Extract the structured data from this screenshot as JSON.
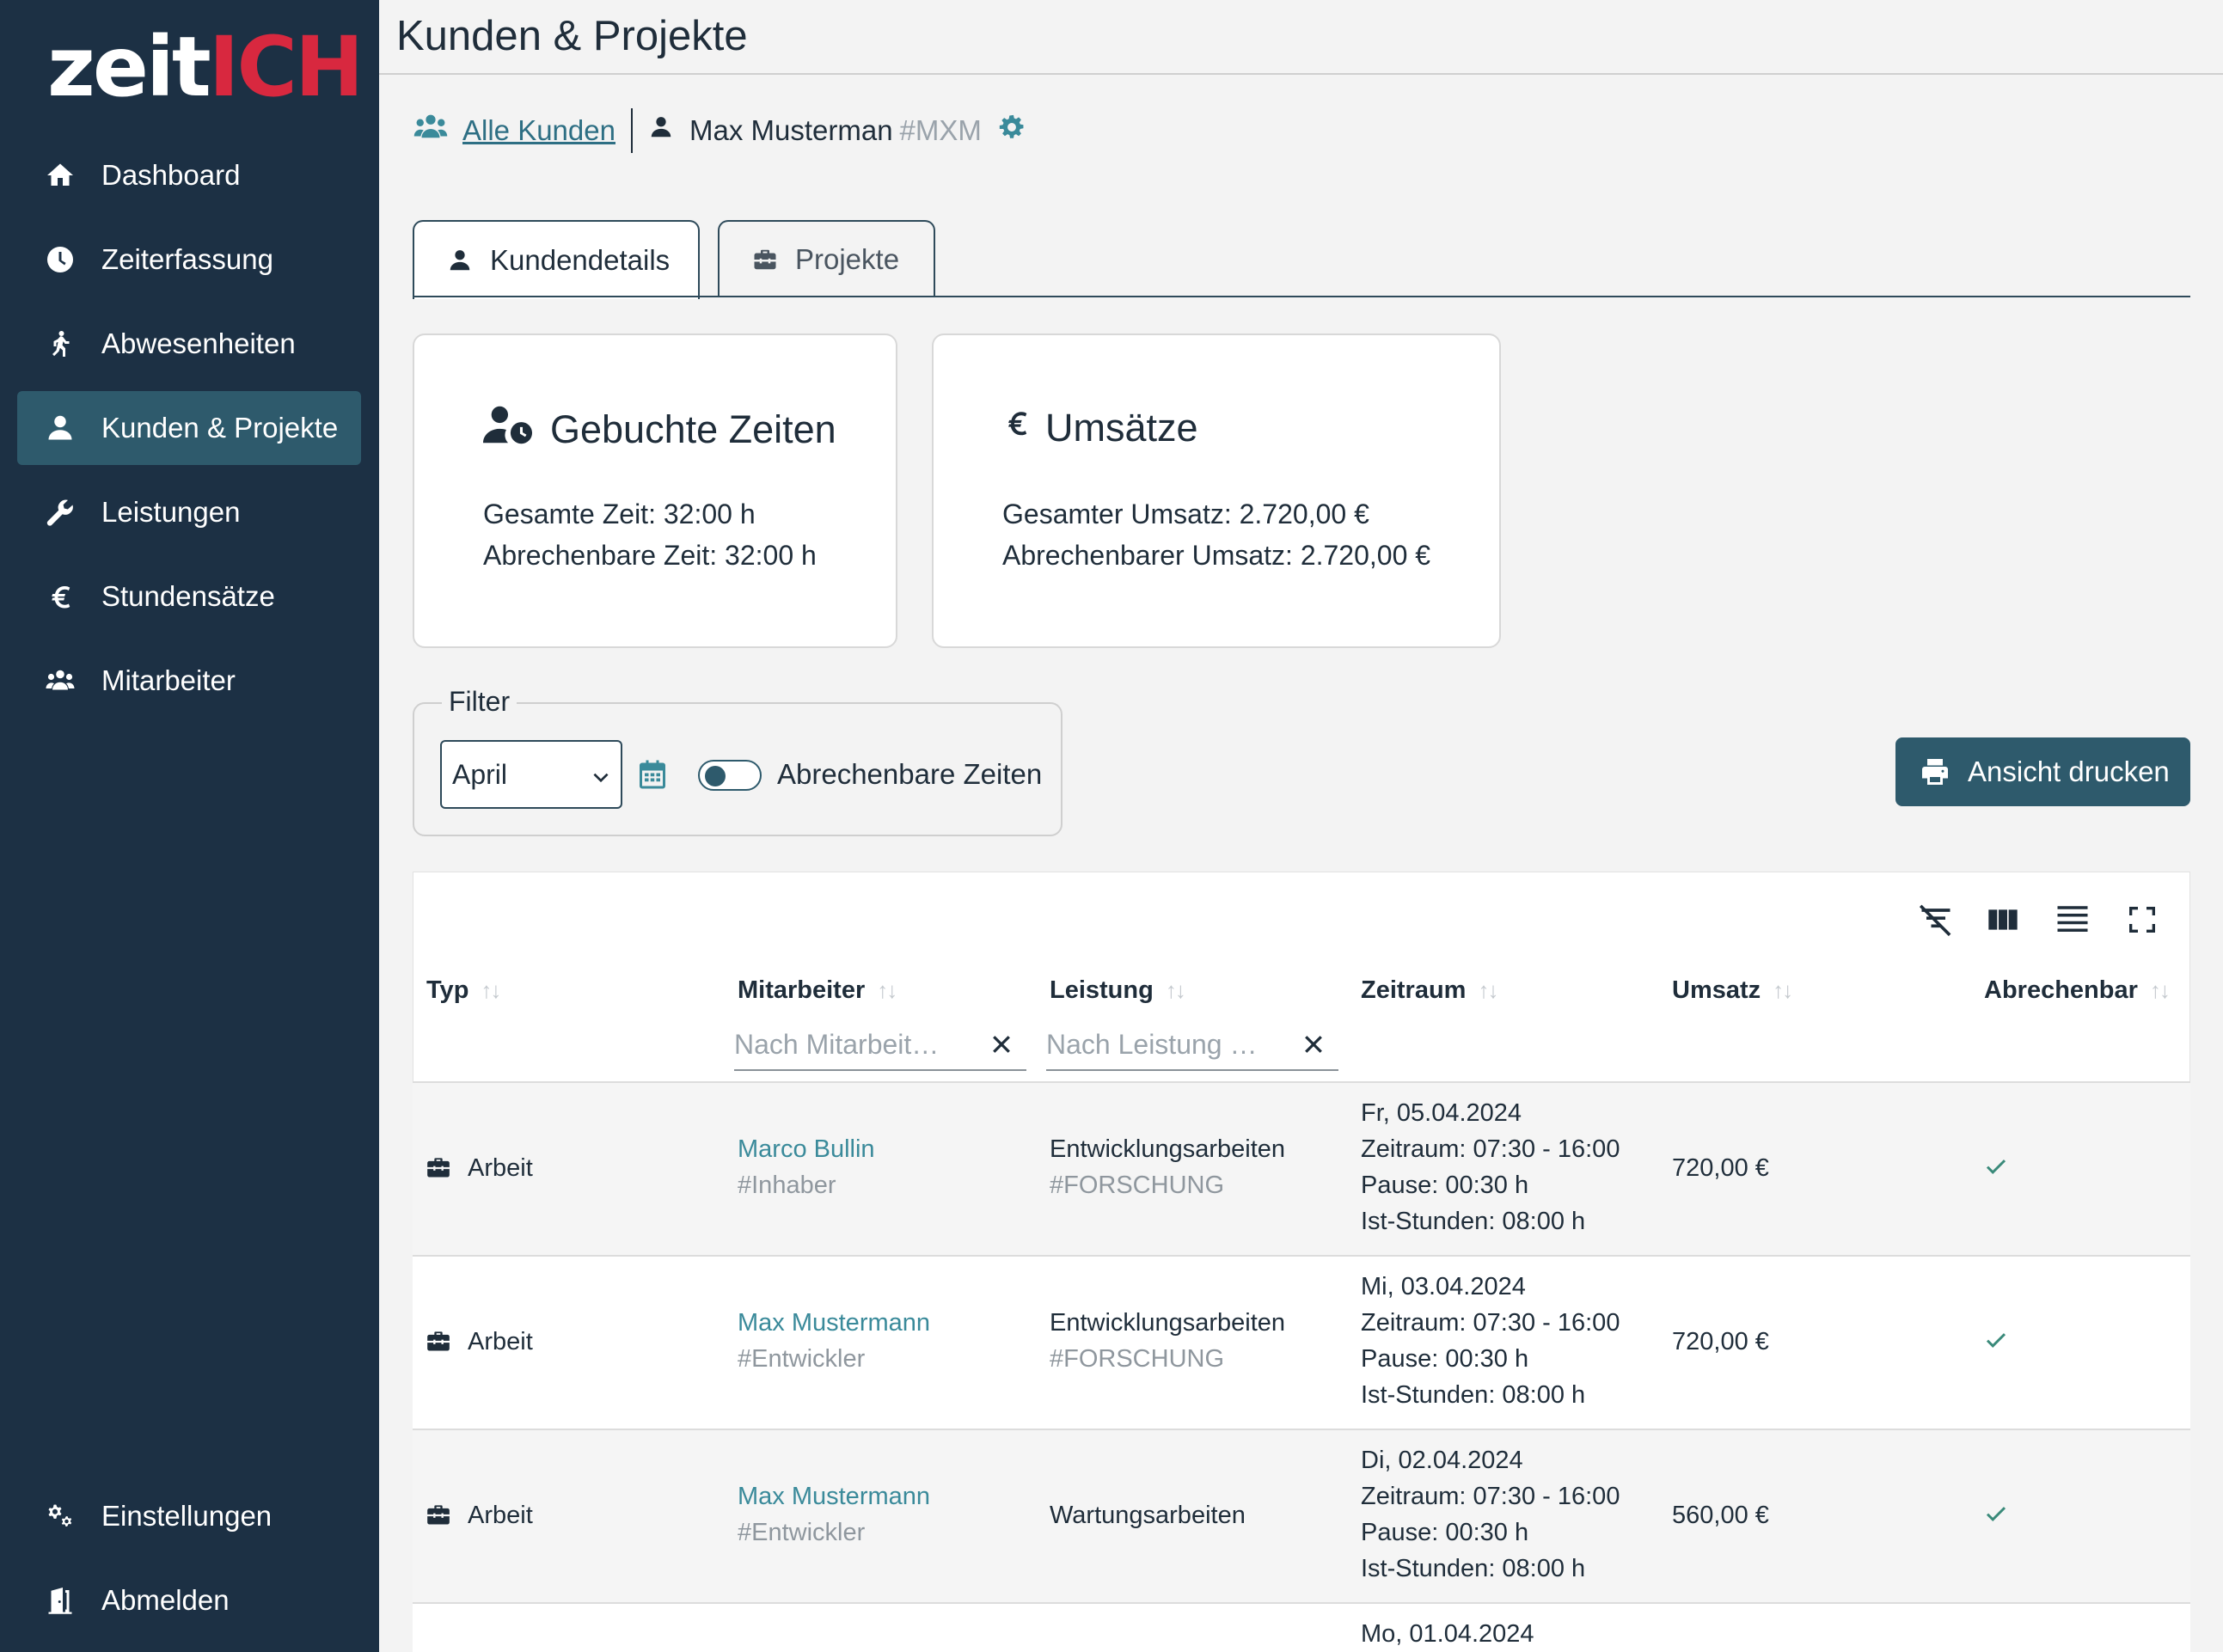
{
  "app": {
    "logo_part1": "zeit",
    "logo_part2": "ICH"
  },
  "sidebar": {
    "items": [
      {
        "label": "Dashboard",
        "icon": "home-icon"
      },
      {
        "label": "Zeiterfassung",
        "icon": "clock-icon"
      },
      {
        "label": "Abwesenheiten",
        "icon": "walking-icon"
      },
      {
        "label": "Kunden & Projekte",
        "icon": "user-icon",
        "active": true
      },
      {
        "label": "Leistungen",
        "icon": "wrench-icon"
      },
      {
        "label": "Stundensätze",
        "icon": "euro-icon"
      },
      {
        "label": "Mitarbeiter",
        "icon": "users-icon"
      }
    ],
    "bottom": [
      {
        "label": "Einstellungen",
        "icon": "gears-icon"
      },
      {
        "label": "Abmelden",
        "icon": "door-icon"
      }
    ]
  },
  "header": {
    "title": "Kunden & Projekte"
  },
  "breadcrumb": {
    "all_customers": "Alle Kunden",
    "customer_name": "Max Musterman",
    "customer_tag": "#MXM"
  },
  "tabs": [
    {
      "label": "Kundendetails",
      "active": true
    },
    {
      "label": "Projekte",
      "active": false
    }
  ],
  "cards": {
    "booked": {
      "title": "Gebuchte Zeiten",
      "line1": "Gesamte Zeit: 32:00 h",
      "line2": "Abrechenbare Zeit: 32:00 h"
    },
    "revenue": {
      "title": "Umsätze",
      "line1": "Gesamter Umsatz: 2.720,00 €",
      "line2": "Abrechenbarer Umsatz: 2.720,00 €"
    }
  },
  "filter": {
    "legend": "Filter",
    "month": "April",
    "toggle_label": "Abrechenbare Zeiten",
    "toggle_on": false
  },
  "print_button": "Ansicht drucken",
  "table": {
    "columns": [
      "Typ",
      "Mitarbeiter",
      "Leistung",
      "Zeitraum",
      "Umsatz",
      "Abrechenbar"
    ],
    "filter_placeholders": {
      "mitarbeiter": "Nach Mitarbeit…",
      "leistung": "Nach Leistung …"
    },
    "rows": [
      {
        "typ": "Arbeit",
        "mitarbeiter": "Marco Bullin",
        "rolle": "#Inhaber",
        "leistung": "Entwicklungsarbeiten",
        "leistung_tag": "#FORSCHUNG",
        "datum": "Fr, 05.04.2024",
        "zeitraum": "Zeitraum: 07:30 - 16:00",
        "pause": "Pause: 00:30 h",
        "ist": "Ist-Stunden: 08:00 h",
        "umsatz": "720,00 €",
        "abrechenbar": true
      },
      {
        "typ": "Arbeit",
        "mitarbeiter": "Max Mustermann",
        "rolle": "#Entwickler",
        "leistung": "Entwicklungsarbeiten",
        "leistung_tag": "#FORSCHUNG",
        "datum": "Mi, 03.04.2024",
        "zeitraum": "Zeitraum: 07:30 - 16:00",
        "pause": "Pause: 00:30 h",
        "ist": "Ist-Stunden: 08:00 h",
        "umsatz": "720,00 €",
        "abrechenbar": true
      },
      {
        "typ": "Arbeit",
        "mitarbeiter": "Max Mustermann",
        "rolle": "#Entwickler",
        "leistung": "Wartungsarbeiten",
        "leistung_tag": "",
        "datum": "Di, 02.04.2024",
        "zeitraum": "Zeitraum: 07:30 - 16:00",
        "pause": "Pause: 00:30 h",
        "ist": "Ist-Stunden: 08:00 h",
        "umsatz": "560,00 €",
        "abrechenbar": true
      },
      {
        "datum": "Mo, 01.04.2024"
      }
    ]
  },
  "colors": {
    "sidebar_bg": "#1c3044",
    "accent": "#2e5a6c",
    "link": "#3a8a9a",
    "logo_red": "#d8283f"
  }
}
